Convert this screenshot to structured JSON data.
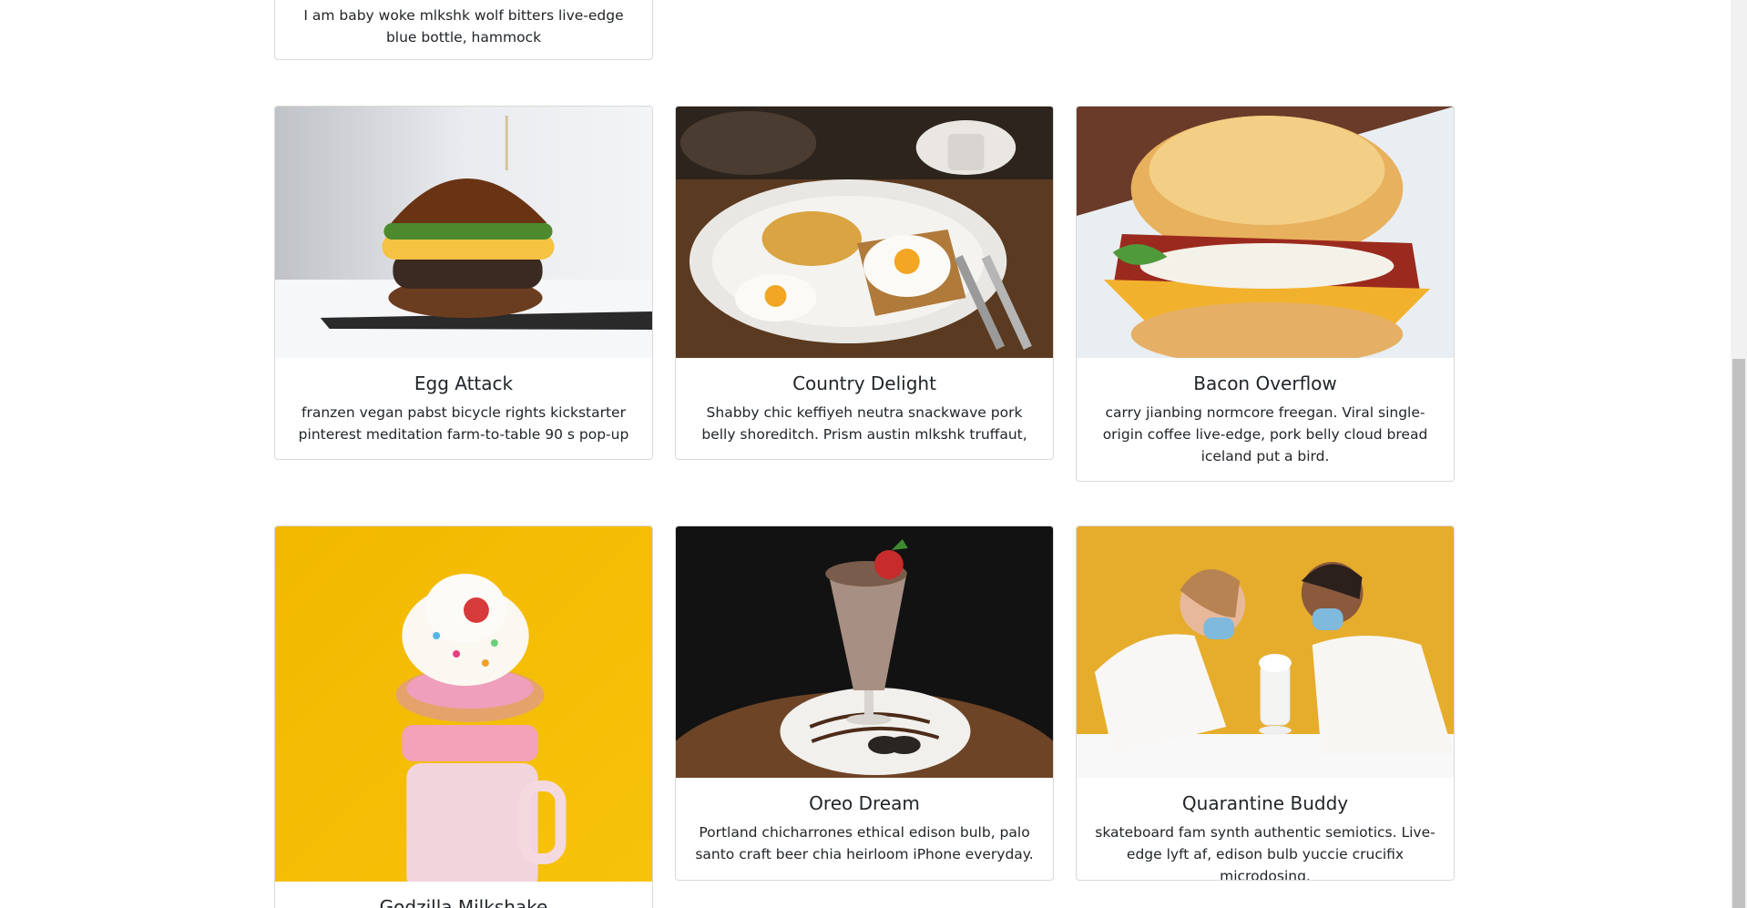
{
  "cards": [
    {
      "title": "",
      "text": "I am baby woke mlkshk wolf bitters live-edge blue bottle, hammock"
    },
    {
      "title": "Egg Attack",
      "text": "franzen vegan pabst bicycle rights kickstarter pinterest meditation farm-to-table 90 s pop-up",
      "image": "burger-photo"
    },
    {
      "title": "Country Delight",
      "text": "Shabby chic keffiyeh neutra snackwave pork belly shoreditch. Prism austin mlkshk truffaut,",
      "image": "breakfast-plate-photo"
    },
    {
      "title": "Bacon Overflow",
      "text": "carry jianbing normcore freegan. Viral single-origin coffee live-edge, pork belly cloud bread iceland put a bird.",
      "image": "bacon-sandwich-photo"
    },
    {
      "title": "Godzilla Milkshake",
      "text": "",
      "image": "freakshake-photo"
    },
    {
      "title": "Oreo Dream",
      "text": "Portland chicharrones ethical edison bulb, palo santo craft beer chia heirloom iPhone everyday.",
      "image": "oreo-milkshake-photo"
    },
    {
      "title": "Quarantine Buddy",
      "text": "skateboard fam synth authentic semiotics. Live-edge lyft af, edison bulb yuccie crucifix microdosing.",
      "image": "couple-milkshake-photo"
    }
  ],
  "colors": {
    "border": "#d9d9d9",
    "text": "#212529",
    "scroll_track": "#f1f1f1",
    "scroll_thumb": "#c1c1c1"
  }
}
